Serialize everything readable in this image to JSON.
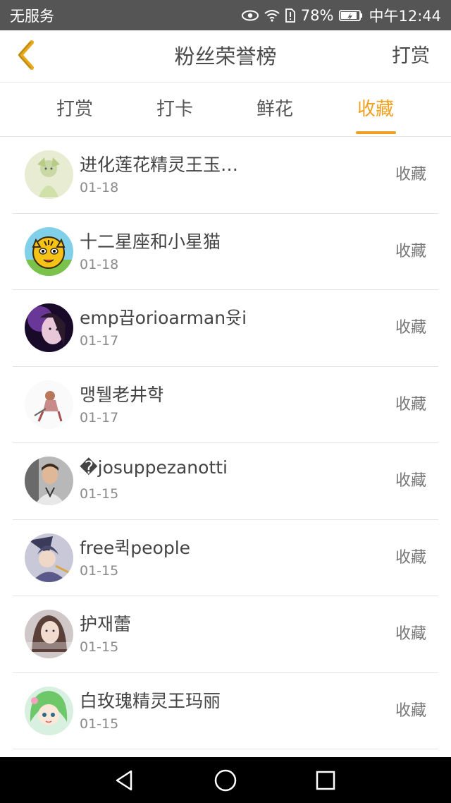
{
  "status_bar": {
    "carrier": "无服务",
    "battery": "78%",
    "time": "中午12:44"
  },
  "nav": {
    "title": "粉丝荣誉榜",
    "action": "打赏"
  },
  "tabs": [
    {
      "label": "打赏",
      "active": false
    },
    {
      "label": "打卡",
      "active": false
    },
    {
      "label": "鲜花",
      "active": false
    },
    {
      "label": "收藏",
      "active": true
    }
  ],
  "accent_color": "#f0a020",
  "list": [
    {
      "name": "进化莲花精灵王玉…",
      "date": "01-18",
      "action": "收藏",
      "avatar": "green-fairy-avatar"
    },
    {
      "name": "十二星座和小星猫",
      "date": "01-18",
      "action": "收藏",
      "avatar": "tiger-cartoon-avatar"
    },
    {
      "name": "emp끕orioarman윳i",
      "date": "01-17",
      "action": "收藏",
      "avatar": "girl-purple-avatar"
    },
    {
      "name": "맹뒐老井햑",
      "date": "01-17",
      "action": "收藏",
      "avatar": "sitting-figure-avatar"
    },
    {
      "name": "�josuppezanotti",
      "date": "01-15",
      "action": "收藏",
      "avatar": "man-photo-avatar"
    },
    {
      "name": "free퀵people",
      "date": "01-15",
      "action": "收藏",
      "avatar": "anime-character-avatar"
    },
    {
      "name": "护재蕾",
      "date": "01-15",
      "action": "收藏",
      "avatar": "girl-photo-avatar"
    },
    {
      "name": "白玫瑰精灵王玛丽",
      "date": "01-15",
      "action": "收藏",
      "avatar": "green-hair-girl-avatar"
    }
  ]
}
